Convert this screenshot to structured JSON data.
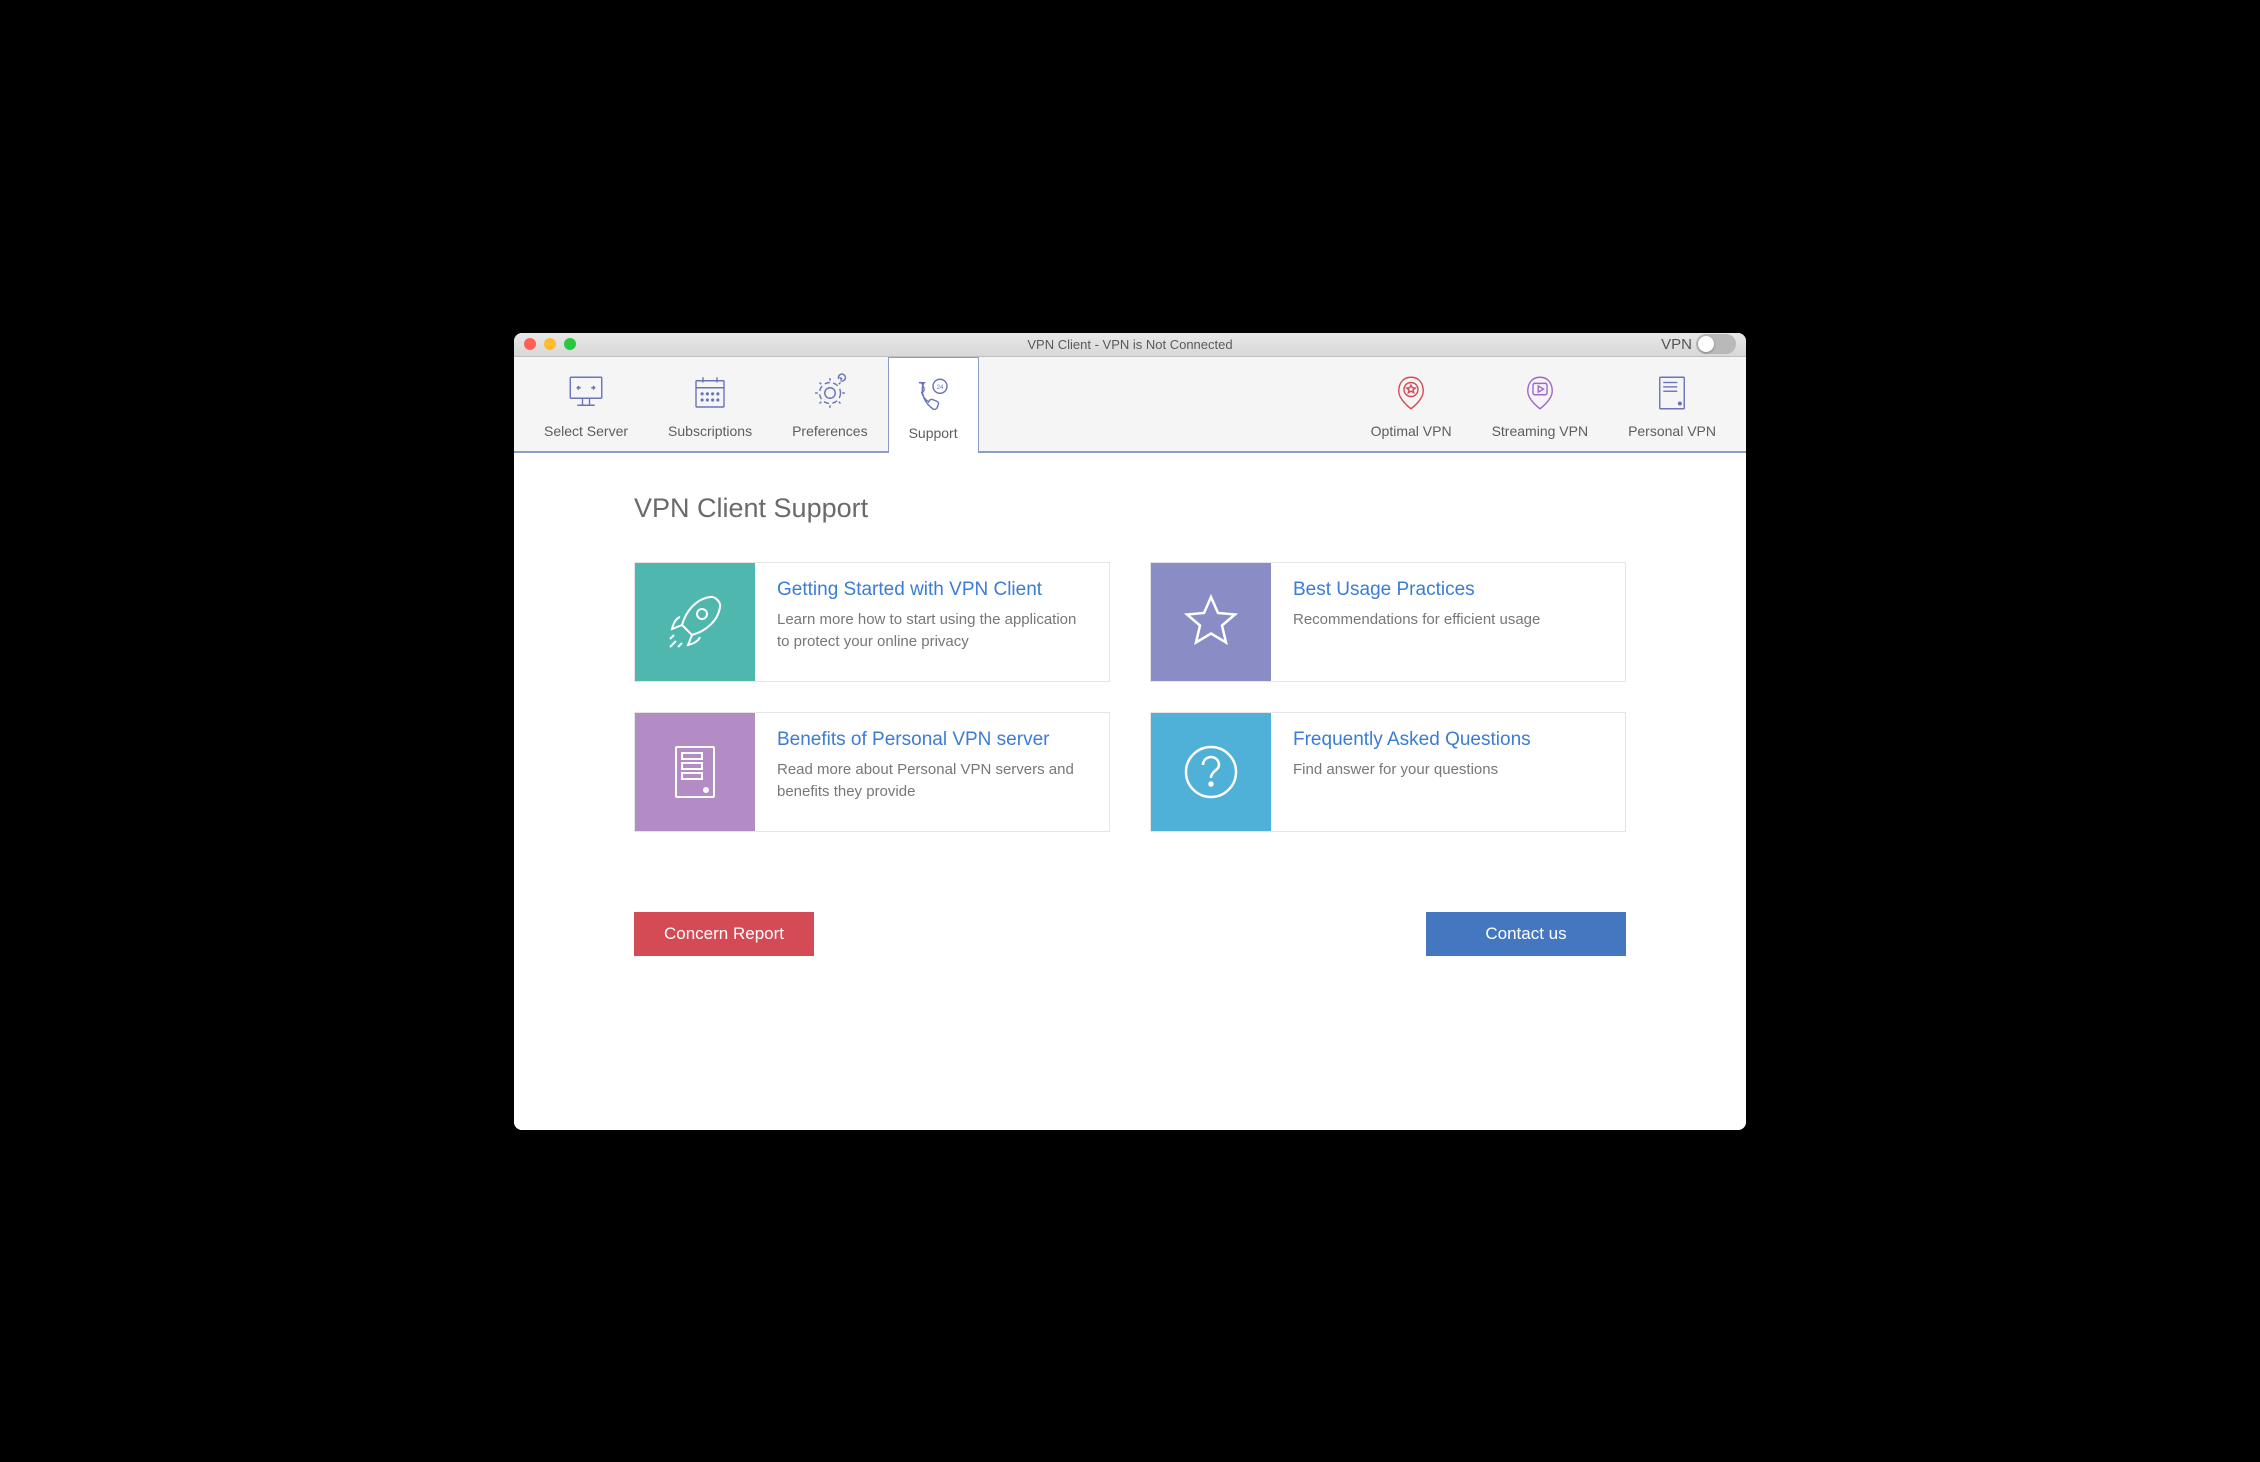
{
  "window": {
    "title": "VPN Client - VPN is Not Connected",
    "vpn_label": "VPN"
  },
  "toolbar": {
    "left": [
      {
        "label": "Select Server"
      },
      {
        "label": "Subscriptions"
      },
      {
        "label": "Preferences"
      },
      {
        "label": "Support",
        "active": true
      }
    ],
    "right": [
      {
        "label": "Optimal VPN"
      },
      {
        "label": "Streaming VPN"
      },
      {
        "label": "Personal VPN"
      }
    ]
  },
  "page": {
    "title": "VPN Client Support"
  },
  "cards": [
    {
      "title": "Getting Started with VPN Client",
      "desc": "Learn more how to start using the application to protect your online privacy"
    },
    {
      "title": "Best Usage Practices",
      "desc": "Recommendations for efficient usage"
    },
    {
      "title": "Benefits of Personal VPN server",
      "desc": "Read more about Personal VPN servers and benefits they provide"
    },
    {
      "title": "Frequently Asked Questions",
      "desc": "Find answer for your questions"
    }
  ],
  "buttons": {
    "concern": "Concern Report",
    "contact": "Contact us"
  }
}
